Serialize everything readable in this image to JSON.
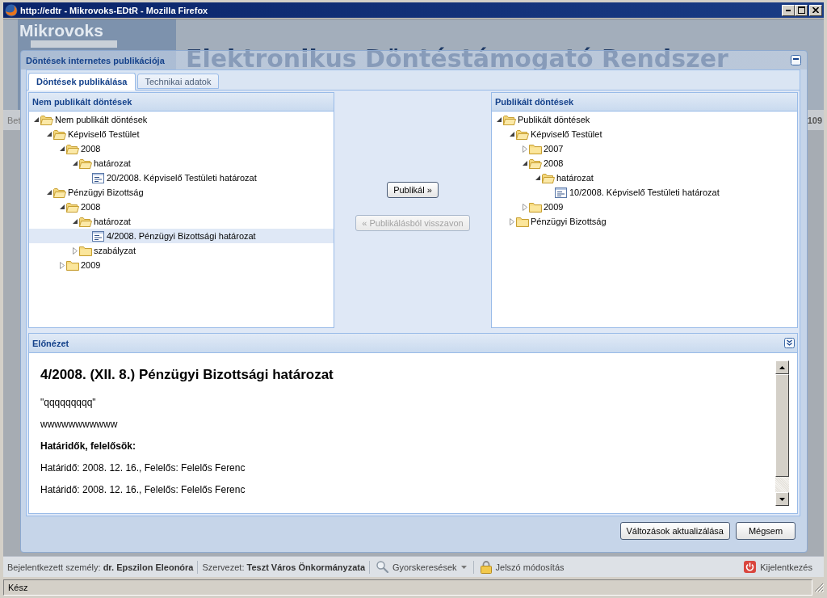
{
  "window": {
    "title": "http://edtr - Mikrovoks-EDtR - Mozilla Firefox"
  },
  "app_header": {
    "logo": "Mikrovoks",
    "subtitle": "Elektronikus Döntéstámogató Rendszer"
  },
  "nav_bar": {
    "left_fragment": "Bet",
    "right_fragment": "109"
  },
  "dialog": {
    "title": "Döntések internetes publikációja",
    "tabs": [
      {
        "label": "Döntések publikálása",
        "selected": true
      },
      {
        "label": "Technikai adatok",
        "selected": false
      }
    ],
    "unpublished_panel": {
      "title": "Nem publikált döntések",
      "tree": [
        {
          "label": "Nem publikált döntések",
          "kind": "folder",
          "expanded": true,
          "selected": false,
          "children": [
            {
              "label": "Képviselő Testület",
              "kind": "folder",
              "expanded": true,
              "selected": false,
              "children": [
                {
                  "label": "2008",
                  "kind": "folder",
                  "expanded": true,
                  "selected": false,
                  "children": [
                    {
                      "label": "határozat",
                      "kind": "folder",
                      "expanded": true,
                      "selected": false,
                      "children": [
                        {
                          "label": "20/2008. Képviselő Testületi határozat",
                          "kind": "document",
                          "selected": false
                        }
                      ]
                    }
                  ]
                }
              ]
            },
            {
              "label": "Pénzügyi Bizottság",
              "kind": "folder",
              "expanded": true,
              "selected": false,
              "children": [
                {
                  "label": "2008",
                  "kind": "folder",
                  "expanded": true,
                  "selected": false,
                  "children": [
                    {
                      "label": "határozat",
                      "kind": "folder",
                      "expanded": true,
                      "selected": false,
                      "children": [
                        {
                          "label": "4/2008. Pénzügyi Bizottsági határozat",
                          "kind": "document",
                          "selected": true
                        }
                      ]
                    },
                    {
                      "label": "szabályzat",
                      "kind": "folder",
                      "expanded": false,
                      "selected": false
                    }
                  ]
                },
                {
                  "label": "2009",
                  "kind": "folder",
                  "expanded": false,
                  "selected": false
                }
              ]
            }
          ]
        }
      ]
    },
    "actions": [
      {
        "label": "Publikál »",
        "disabled": false
      },
      {
        "label": "« Publikálásból visszavon",
        "disabled": true
      }
    ],
    "published_panel": {
      "title": "Publikált döntések",
      "tree": [
        {
          "label": "Publikált döntések",
          "kind": "folder",
          "expanded": true,
          "selected": false,
          "children": [
            {
              "label": "Képviselő Testület",
              "kind": "folder",
              "expanded": true,
              "selected": false,
              "children": [
                {
                  "label": "2007",
                  "kind": "folder",
                  "expanded": false,
                  "selected": false
                },
                {
                  "label": "2008",
                  "kind": "folder",
                  "expanded": true,
                  "selected": false,
                  "children": [
                    {
                      "label": "határozat",
                      "kind": "folder",
                      "expanded": true,
                      "selected": false,
                      "children": [
                        {
                          "label": "10/2008. Képviselő Testületi határozat",
                          "kind": "document",
                          "selected": false
                        }
                      ]
                    }
                  ]
                },
                {
                  "label": "2009",
                  "kind": "folder",
                  "expanded": false,
                  "selected": false
                }
              ]
            },
            {
              "label": "Pénzügyi Bizottság",
              "kind": "folder",
              "expanded": false,
              "selected": false
            }
          ]
        }
      ]
    },
    "preview": {
      "title": "Előnézet",
      "heading": "4/2008. (XII. 8.) Pénzügyi Bizottsági határozat",
      "paragraphs": [
        {
          "kind": "text",
          "text": "\"qqqqqqqqq\""
        },
        {
          "kind": "text",
          "text": "wwwwwwwwwww"
        },
        {
          "kind": "heading",
          "text": "Határidők, felelősök:"
        },
        {
          "kind": "text",
          "text": "Határidő: 2008. 12. 16., Felelős: Felelős Ferenc"
        },
        {
          "kind": "text",
          "text": "Határidő: 2008. 12. 16., Felelős: Felelős Ferenc"
        }
      ]
    },
    "footer_buttons": [
      "Változások aktualizálása",
      "Mégsem"
    ]
  },
  "app_status_bar": {
    "user": "Bejelentkezett személy: **dr. Epszilon Eleonóra**",
    "organization": "Szervezet: **Teszt Város Önkormányzata**",
    "quick_search": "Gyorskeresések",
    "change_password": "Jelszó módosítás",
    "logout": "Kijelentkezés"
  },
  "browser_status_bar": {
    "text": "Kész"
  }
}
